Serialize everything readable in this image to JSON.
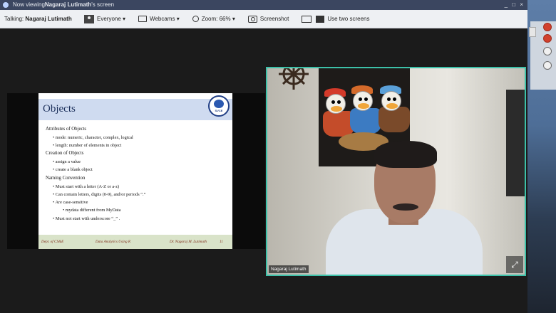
{
  "titlebar": {
    "prefix": "Now viewing ",
    "presenter": "Nagaraj Lutimath",
    "suffix": "'s screen",
    "controls": "_ □ ×"
  },
  "toolbar": {
    "talking_label": "Talking:",
    "talking_name": "Nagaraj Lutimath",
    "everyone": "Everyone ▾",
    "webcams": "Webcams ▾",
    "zoom": "Zoom: 66% ▾",
    "screenshot": "Screenshot",
    "two_screens": "Use two screens"
  },
  "slide": {
    "title": "Objects",
    "logo_text": "SVCE",
    "lines": [
      {
        "kind": "h",
        "text": "Attributes of Objects"
      },
      {
        "kind": "b",
        "text": "mode: numeric, character, complex, logical"
      },
      {
        "kind": "b",
        "text": "length: number of elements in object"
      },
      {
        "kind": "h",
        "text": "Creation of Objects"
      },
      {
        "kind": "b",
        "text": "assign a value"
      },
      {
        "kind": "b",
        "text": "create a blank object"
      },
      {
        "kind": "h",
        "text": "Naming Convention"
      },
      {
        "kind": "b",
        "text": "Must start with a letter (A-Z or a-z)"
      },
      {
        "kind": "b",
        "text": "Can contain letters, digits (0-9), and/or periods “.”"
      },
      {
        "kind": "b",
        "text": "Are case-sensitive"
      },
      {
        "kind": "bb",
        "text": "mydata different from MyData"
      },
      {
        "kind": "b",
        "text": "Must not start with underscore “_” ."
      }
    ],
    "footer_left": "Dept. of CS&E",
    "footer_center": "Data Analytics Using R",
    "footer_right": "Dr. Nagaraj M. Lutimath",
    "page_number": "11"
  },
  "video": {
    "name": "Nagaraj Lutimath",
    "expand_icon": "expand-icon"
  }
}
